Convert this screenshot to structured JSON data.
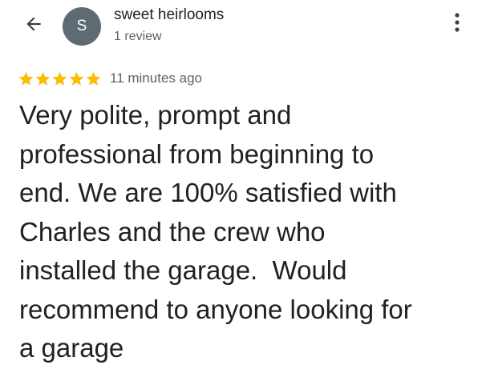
{
  "header": {
    "back_icon": "arrow-left-icon",
    "avatar_initial": "S",
    "avatar_color": "#5f6b73",
    "reviewer_name": "sweet heirlooms",
    "review_count": "1 review",
    "more_icon": "more-vertical-icon"
  },
  "review": {
    "rating": 5,
    "rating_max": 5,
    "star_color": "#fbbc04",
    "timestamp": "11 minutes ago",
    "text": "Very polite, prompt and\nprofessional from beginning to\nend. We are 100% satisfied with\nCharles and the crew who\ninstalled the garage.  Would\nrecommend to anyone looking for\na garage"
  }
}
